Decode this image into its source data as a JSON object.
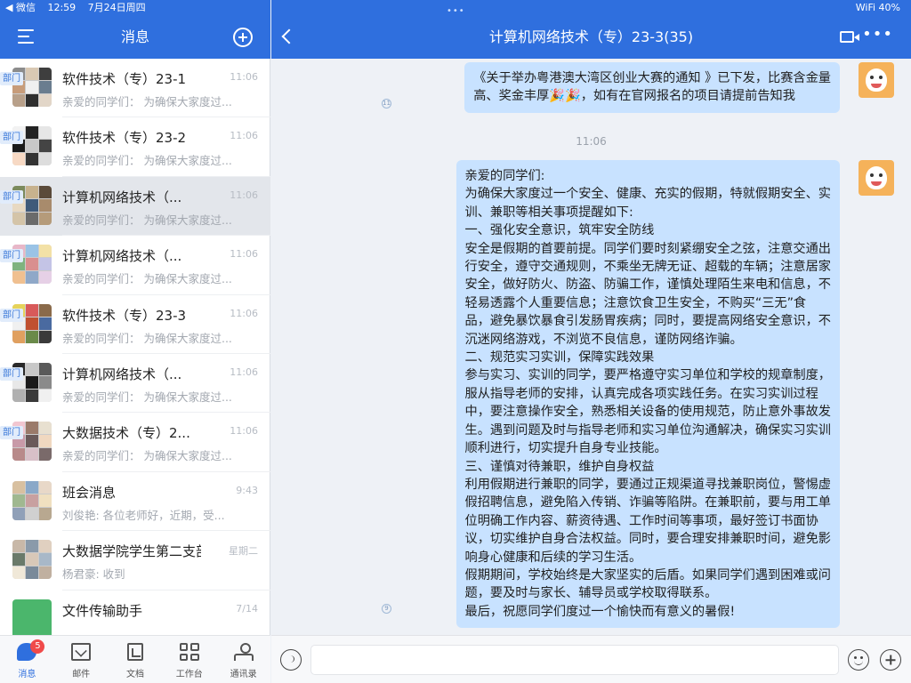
{
  "status_bar": {
    "carrier": "◀ 微信",
    "time": "12:59",
    "date": "7月24日周四",
    "more_dots": "•••",
    "wifi": "WiFi",
    "battery": "40%"
  },
  "sidebar": {
    "title": "消息",
    "conversations": [
      {
        "name": "软件技术（专）23-1",
        "tag": "部门",
        "time": "11:06",
        "preview": "亲爱的同学们： 为确保大家度过...",
        "avatar_colors": [
          "#8c8c8c",
          "#d9c9b4",
          "#3e3e3e",
          "#c79c7a",
          "#f0f0f0",
          "#6a7d8f",
          "#b8a08a",
          "#2f2f2f",
          "#e2d6c8"
        ]
      },
      {
        "name": "软件技术（专）23-2",
        "tag": "部门",
        "time": "11:06",
        "preview": "亲爱的同学们： 为确保大家度过...",
        "avatar_colors": [
          "#f2f2f2",
          "#222222",
          "#e6e6e6",
          "#1a1a1a",
          "#c8c8c8",
          "#444444",
          "#f7d9c4",
          "#333333",
          "#dddddd"
        ]
      },
      {
        "name": "计算机网络技术（...",
        "tag": "部门",
        "time": "11:06",
        "preview": "亲爱的同学们： 为确保大家度过...",
        "avatar_colors": [
          "#7b8a5c",
          "#c7b28e",
          "#5a4a3a",
          "#e8d9c2",
          "#3f5a7a",
          "#a88b6c",
          "#d4c4a8",
          "#6b6b6b",
          "#b59b7a"
        ]
      },
      {
        "name": "计算机网络技术（...",
        "tag": "部门",
        "time": "11:06",
        "preview": "亲爱的同学们： 为确保大家度过...",
        "avatar_colors": [
          "#e8b7c8",
          "#9ac3e6",
          "#f3e1a6",
          "#7fb37f",
          "#d98f8f",
          "#c4c4e6",
          "#f0c090",
          "#8fa8c8",
          "#e6d0e6"
        ]
      },
      {
        "name": "软件技术（专）23-3",
        "tag": "部门",
        "time": "11:06",
        "preview": "亲爱的同学们： 为确保大家度过...",
        "avatar_colors": [
          "#e6d35a",
          "#d85a5a",
          "#8a6a4a",
          "#f0f0f0",
          "#c05030",
          "#4a6aa0",
          "#e0a060",
          "#6a8a4a",
          "#3a3a3a"
        ]
      },
      {
        "name": "计算机网络技术（...",
        "tag": "部门",
        "time": "11:06",
        "preview": "亲爱的同学们： 为确保大家度过...",
        "avatar_colors": [
          "#2a2a2a",
          "#c8c8c8",
          "#5a5a5a",
          "#e8e8e8",
          "#1a1a1a",
          "#8a8a8a",
          "#b0b0b0",
          "#3a3a3a",
          "#f0f0f0"
        ]
      },
      {
        "name": "大数据技术（专）2...",
        "tag": "部门",
        "time": "11:06",
        "preview": "亲爱的同学们： 为确保大家度过...",
        "avatar_colors": [
          "#f2c6d0",
          "#9a7a6a",
          "#e8e0d0",
          "#c89aa8",
          "#6a5a5a",
          "#f0d8c0",
          "#b88a8a",
          "#d8c0c8",
          "#7a6a6a"
        ]
      },
      {
        "name": "班会消息",
        "tag": "",
        "time": "9:43",
        "preview": "刘俊艳: 各位老师好，近期，受...",
        "avatar_colors": [
          "#d8c0a0",
          "#8aa8c8",
          "#e8d8c8",
          "#a0b890",
          "#c8a0a0",
          "#f0e0c0",
          "#90a0b8",
          "#d0d0d0",
          "#b8a890"
        ]
      },
      {
        "name": "大数据学院学生第二支部",
        "tag": "",
        "time": "星期二",
        "preview": "杨君豪: 收到",
        "avatar_colors": [
          "#c8b8a8",
          "#8a9aaa",
          "#e0d0c0",
          "#6a7a6a",
          "#d8c8b8",
          "#a8b8c8",
          "#f0e8d8",
          "#7a8a9a",
          "#c0b0a0"
        ]
      },
      {
        "name": "文件传输助手",
        "tag": "",
        "time": "7/14",
        "preview": "",
        "avatar_colors": []
      }
    ]
  },
  "tabbar": {
    "items": [
      {
        "label": "消息",
        "badge": "5"
      },
      {
        "label": "邮件"
      },
      {
        "label": "文档"
      },
      {
        "label": "工作台"
      },
      {
        "label": "通讯录"
      }
    ]
  },
  "chat": {
    "title": "计算机网络技术（专）23-3(35)",
    "time_separator": "11:06",
    "messages": [
      {
        "read": "11",
        "lines": [
          "《关于举办粤港澳大湾区创业大赛的通知 》已下发，比赛含金量",
          "高、奖金丰厚🎉🎉，如有在官网报名的项目请提前告知我"
        ]
      },
      {
        "read": "9",
        "lines": [
          "亲爱的同学们:",
          "为确保大家度过一个安全、健康、充实的假期，特就假期安全、实",
          "训、兼职等相关事项提醒如下:",
          "一、强化安全意识，筑牢安全防线",
          "安全是假期的首要前提。同学们要时刻紧绷安全之弦，注意交通出",
          "行安全，遵守交通规则，不乘坐无牌无证、超载的车辆；注意居家",
          "安全，做好防火、防盗、防骗工作，谨慎处理陌生来电和信息，不",
          "轻易透露个人重要信息；注意饮食卫生安全，不购买“三无”食",
          "品，避免暴饮暴食引发肠胃疾病；同时，要提高网络安全意识，不",
          "沉迷网络游戏，不浏览不良信息，谨防网络诈骗。",
          "二、规范实习实训，保障实践效果",
          "参与实习、实训的同学，要严格遵守实习单位和学校的规章制度，",
          "服从指导老师的安排，认真完成各项实践任务。在实习实训过程",
          "中，要注意操作安全，熟悉相关设备的使用规范，防止意外事故发",
          "生。遇到问题及时与指导老师和实习单位沟通解决，确保实习实训",
          "顺利进行，切实提升自身专业技能。",
          "三、谨慎对待兼职，维护自身权益",
          "利用假期进行兼职的同学，要通过正规渠道寻找兼职岗位，警惕虚",
          "假招聘信息，避免陷入传销、诈骗等陷阱。在兼职前，要与用工单",
          "位明确工作内容、薪资待遇、工作时间等事项，最好签订书面协",
          "议，切实维护自身合法权益。同时，要合理安排兼职时间，避免影",
          "响身心健康和后续的学习生活。",
          "假期期间，学校始终是大家坚实的后盾。如果同学们遇到困难或问",
          "题，要及时与家长、辅导员或学校取得联系。",
          "最后，祝愿同学们度过一个愉快而有意义的暑假!"
        ]
      }
    ]
  },
  "input": {
    "value": "",
    "placeholder": ""
  },
  "colors": {
    "brand_blue": "#2f6fde",
    "bubble": "#c8e2ff",
    "tag_text": "#3a78d9",
    "badge_red": "#f04a4a"
  }
}
